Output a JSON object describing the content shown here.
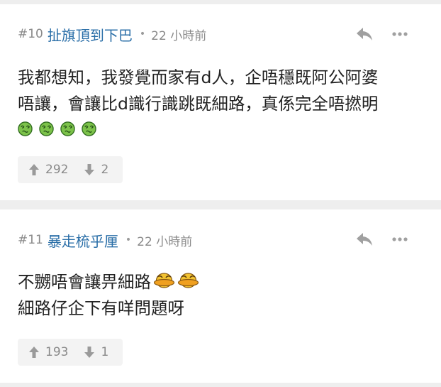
{
  "posts": [
    {
      "number": "#10",
      "username": "扯旗頂到下巴",
      "separator": "•",
      "time": "22 小時前",
      "lines": [
        "我都想知，我發覺而家有d人，企唔穩既阿公阿婆",
        "唔讓，會讓比d識行識跳既細路，真係完全唔撚明"
      ],
      "upvotes": "292",
      "downvotes": "2"
    },
    {
      "number": "#11",
      "username": "暴走梳乎厘",
      "separator": "•",
      "time": "22 小時前",
      "lines": [
        "不嬲唔會讓畀細路",
        "細路仔企下有咩問題呀"
      ],
      "upvotes": "193",
      "downvotes": "1"
    }
  ],
  "icons": {
    "reply": "reply-arrow-icon",
    "more": "more-dots-icon",
    "upvote": "arrow-up-icon",
    "downvote": "arrow-down-icon",
    "emoji_sad": "confused-green-face-icon",
    "emoji_duck": "yellow-duck-icon"
  },
  "colors": {
    "username": "#2b6fa8",
    "meta_text": "#8a8a8a",
    "body_text": "#222222",
    "icon_gray": "#9a9a9a",
    "page_bg": "#eeeeee"
  }
}
